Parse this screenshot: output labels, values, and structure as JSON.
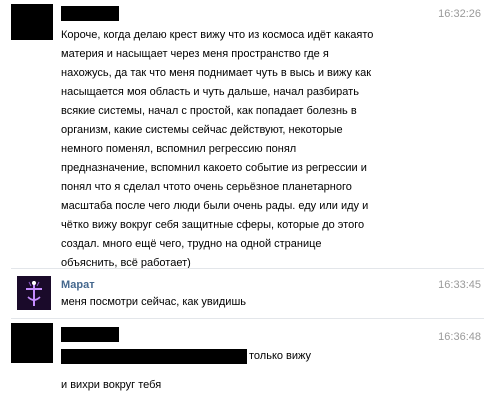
{
  "messages": [
    {
      "time": "16:32:26",
      "lines": [
        "Короче, когда делаю крест вижу что из космоса идёт какаято",
        "материя и насыщает через меня пространство где я",
        "нахожусь, да так что меня поднимает чуть в высь и вижу как",
        "насыщается моя область и чуть дальше, начал разбирать",
        "всякие системы, начал с простой, как попадает болезнь в",
        "организм, какие системы сейчас действуют, некоторые",
        "немного поменял, вспомнил регрессию понял",
        "предназначение, вспомнил какоето событие из регрессии и",
        "понял что я сделал чтото очень серьёзное планетарного",
        "масштаба после чего люди были очень рады. еду или иду и",
        "чётко вижу вокруг себя защитные сферы, которые до этого",
        "создал. много ещё чего, трудно на одной странице",
        "объяснить, всё работает)"
      ]
    },
    {
      "author": "Марат",
      "time": "16:33:45",
      "text": "меня посмотри сейчас, как увидишь"
    },
    {
      "time": "16:36:48",
      "lines": [
        "только вижу",
        "и вихри вокруг тебя"
      ]
    }
  ],
  "colors": {
    "author": "#45688e",
    "time": "#9a9a9a",
    "redaction": "#000000",
    "avatar_bg": "#1a0a2a",
    "avatar_glow": "#c58cff"
  }
}
